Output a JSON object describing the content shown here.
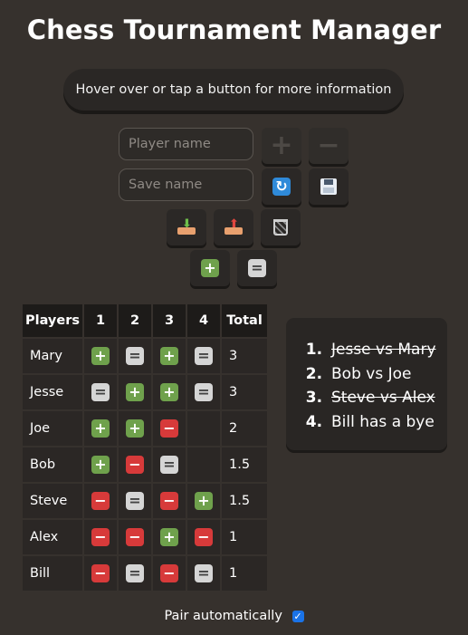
{
  "app": {
    "title": "Chess Tournament Manager"
  },
  "info": {
    "text": "Hover over or tap a button for more information"
  },
  "player_input": {
    "placeholder": "Player name",
    "value": ""
  },
  "save_input": {
    "placeholder": "Save name",
    "value": ""
  },
  "icons": {
    "add_player": "plus-icon",
    "remove_player": "minus-icon",
    "refresh": "refresh-icon",
    "save": "floppy-disk-icon",
    "download": "download-tray-icon",
    "upload": "upload-tray-icon",
    "delete": "wastebasket-icon",
    "add_round": "plus-square-icon",
    "remove_round": "equals-square-icon"
  },
  "colors": {
    "win": "#6fa14c",
    "draw": "#d5d5d5",
    "loss": "#d73a3a",
    "accent": "#2f8ad9"
  },
  "standings": {
    "headers": [
      "Players",
      "1",
      "2",
      "3",
      "4",
      "Total"
    ],
    "rows": [
      {
        "name": "Mary",
        "results": [
          "win",
          "draw",
          "win",
          "draw"
        ],
        "total": "3"
      },
      {
        "name": "Jesse",
        "results": [
          "draw",
          "win",
          "win",
          "draw"
        ],
        "total": "3"
      },
      {
        "name": "Joe",
        "results": [
          "win",
          "win",
          "loss",
          ""
        ],
        "total": "2"
      },
      {
        "name": "Bob",
        "results": [
          "win",
          "loss",
          "draw",
          ""
        ],
        "total": "1.5"
      },
      {
        "name": "Steve",
        "results": [
          "loss",
          "draw",
          "loss",
          "win"
        ],
        "total": "1.5"
      },
      {
        "name": "Alex",
        "results": [
          "loss",
          "loss",
          "win",
          "loss"
        ],
        "total": "1"
      },
      {
        "name": "Bill",
        "results": [
          "loss",
          "draw",
          "loss",
          "draw"
        ],
        "total": "1"
      }
    ]
  },
  "pairings": [
    {
      "text": "Jesse vs Mary",
      "completed": true
    },
    {
      "text": "Bob vs Joe",
      "completed": false
    },
    {
      "text": "Steve vs Alex",
      "completed": true
    },
    {
      "text": "Bill has a bye",
      "completed": false
    }
  ],
  "auto_pair": {
    "label": "Pair automatically",
    "checked": true
  }
}
